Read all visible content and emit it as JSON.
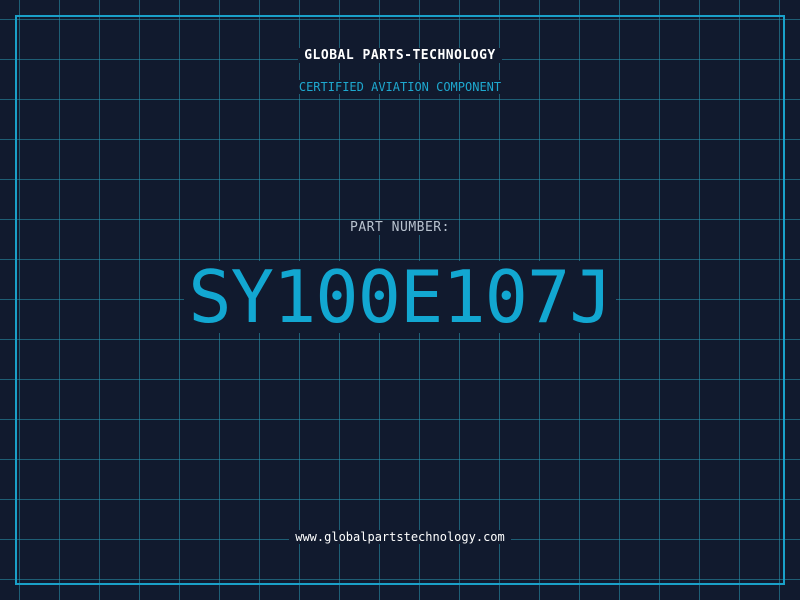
{
  "header": {
    "company": "GLOBAL PARTS-TECHNOLOGY",
    "subtitle": "CERTIFIED AVIATION COMPONENT"
  },
  "main": {
    "label": "PART NUMBER:",
    "part_number": "SY100E107J"
  },
  "footer": {
    "url": "www.globalpartstechnology.com"
  },
  "colors": {
    "background": "#111a2e",
    "grid": "#2896af",
    "accent": "#12a7d1",
    "text": "#ffffff"
  }
}
